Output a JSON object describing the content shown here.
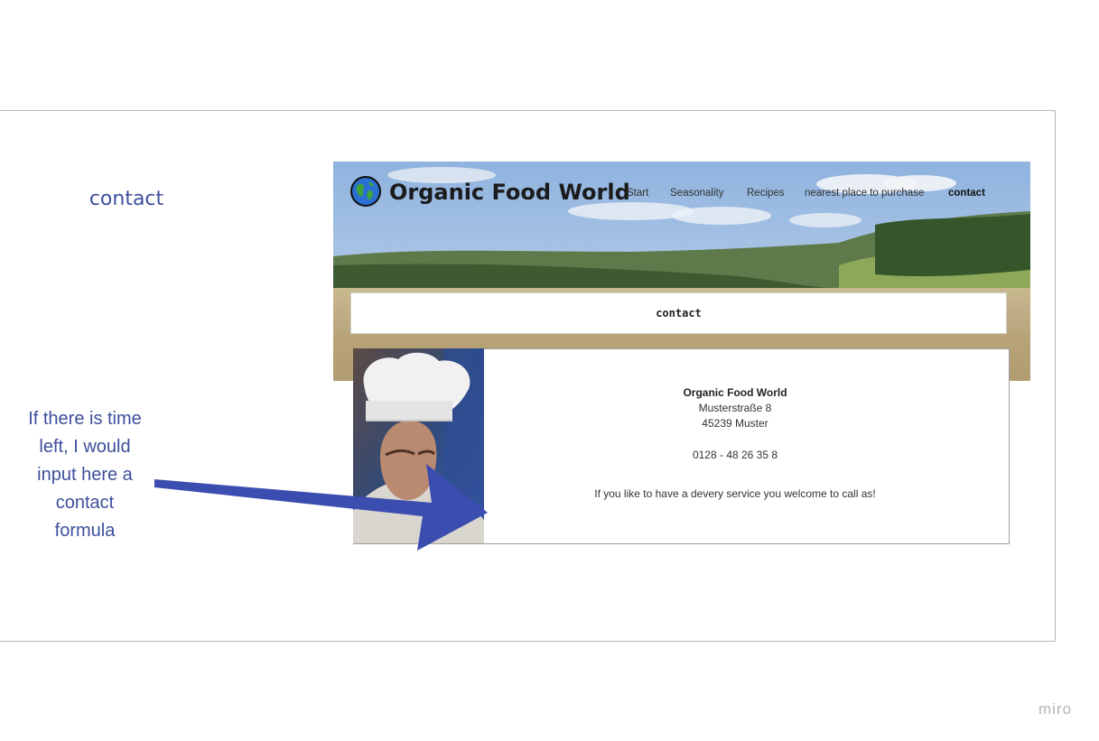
{
  "board": {
    "page_title": "contact",
    "note_lines": [
      "If there is time",
      "left, I would",
      "input here a",
      "contact",
      "formula"
    ],
    "watermark": "miro",
    "arrow_color": "#3c4db0"
  },
  "site": {
    "brand": "Organic Food World",
    "logo_icon": "globe-icon",
    "nav": [
      {
        "label": "Start",
        "active": false
      },
      {
        "label": "Seasonality",
        "active": false
      },
      {
        "label": "Recipes",
        "active": false
      },
      {
        "label": "nearest place to purchase",
        "active": false
      },
      {
        "label": "contact",
        "active": true
      }
    ],
    "section_label": "contact",
    "contact": {
      "company": "Organic Food World",
      "street": "Musterstraße 8",
      "city": "45239 Muster",
      "phone": "0128 - 48 26 35 8",
      "delivery_text": "If you like to have a devery service you welcome to call as!"
    }
  }
}
